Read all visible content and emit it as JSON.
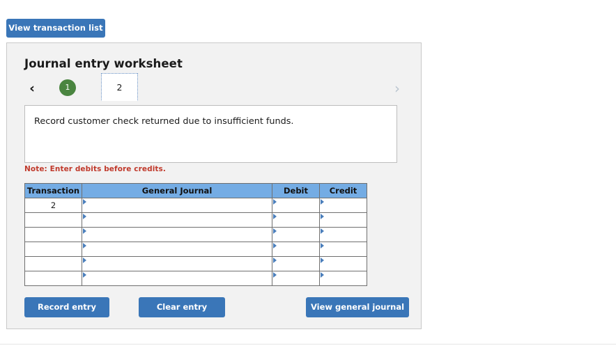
{
  "toolbar": {
    "view_transaction_list_label": "View transaction list"
  },
  "worksheet": {
    "title": "Journal entry worksheet",
    "nav": {
      "prev_icon": "chevron-left-icon",
      "prev_glyph": "‹",
      "next_icon": "chevron-right-icon",
      "next_glyph": "›"
    },
    "tabs": [
      {
        "label": "1",
        "state": "completed"
      },
      {
        "label": "2",
        "state": "active"
      }
    ],
    "prompt": "Record customer check returned due to insufficient funds.",
    "note": "Note: Enter debits before credits."
  },
  "journal_table": {
    "columns": [
      "Transaction",
      "General Journal",
      "Debit",
      "Credit"
    ],
    "rows": [
      {
        "transaction": "2",
        "general_journal": "",
        "debit": "",
        "credit": ""
      },
      {
        "transaction": "",
        "general_journal": "",
        "debit": "",
        "credit": ""
      },
      {
        "transaction": "",
        "general_journal": "",
        "debit": "",
        "credit": ""
      },
      {
        "transaction": "",
        "general_journal": "",
        "debit": "",
        "credit": ""
      },
      {
        "transaction": "",
        "general_journal": "",
        "debit": "",
        "credit": ""
      },
      {
        "transaction": "",
        "general_journal": "",
        "debit": "",
        "credit": ""
      }
    ]
  },
  "actions": {
    "record_entry_label": "Record entry",
    "clear_entry_label": "Clear entry",
    "view_general_journal_label": "View general journal"
  },
  "colors": {
    "button_blue": "#3a76b8",
    "table_header_blue": "#74ace4",
    "completed_tab_green": "#4a8540",
    "note_red": "#c0392b",
    "panel_gray": "#f2f2f2"
  }
}
